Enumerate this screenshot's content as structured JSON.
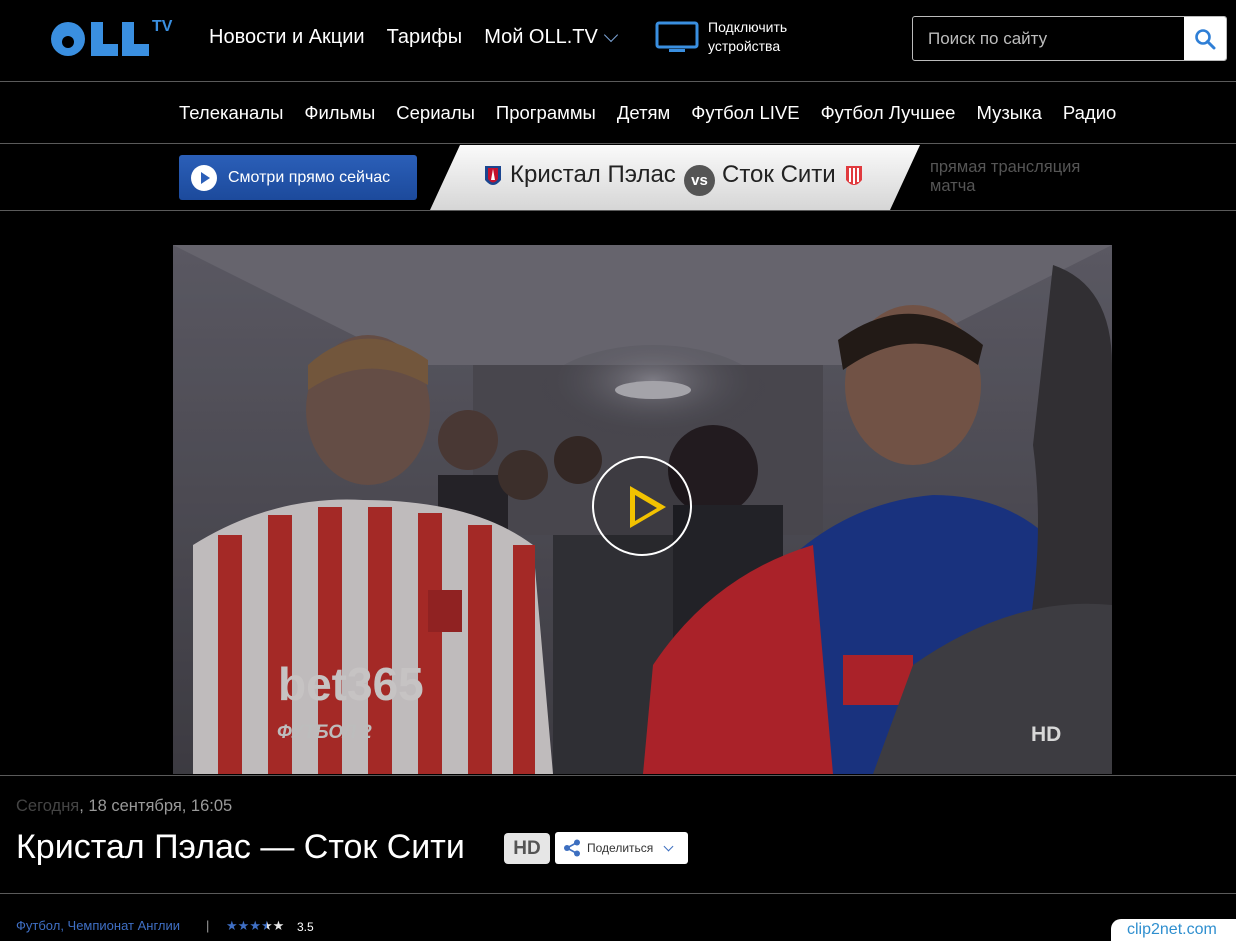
{
  "header": {
    "logo_text": "OLL",
    "logo_sup": "TV",
    "nav": [
      {
        "label": "Новости и Акции"
      },
      {
        "label": "Тарифы"
      },
      {
        "label": "Мой OLL.TV"
      }
    ],
    "devices_label": "Подключить устройства",
    "search_placeholder": "Поиск по сайту"
  },
  "categories": [
    "Телеканалы",
    "Фильмы",
    "Сериалы",
    "Программы",
    "Детям",
    "Футбол LIVE",
    "Футбол Лучшее",
    "Музыка",
    "Радио"
  ],
  "live": {
    "watch_label": "Смотри прямо сейчас",
    "team1": "Кристал Пэлас",
    "vs": "vs",
    "team2": "Сток Сити",
    "live_text": "прямая трансляция матча"
  },
  "video": {
    "hd_mark": "HD",
    "channel_logo": "ФУТБОЛ 2"
  },
  "info": {
    "date_today": "Сегодня",
    "date_rest": ", 18 сентября, 16:05",
    "title": "Кристал Пэлас — Сток Сити",
    "hd_badge": "HD",
    "share_label": "Поделиться",
    "tags": "Футбол, Чемпионат Англии",
    "separator": "|",
    "rating": "3.5",
    "rating_value": 3.5,
    "rating_max": 5
  },
  "watermark": "clip2net.com",
  "colors": {
    "accent_blue": "#3f6fc4",
    "logo_blue": "#3a8fe0",
    "play_yellow": "#f2c200"
  }
}
